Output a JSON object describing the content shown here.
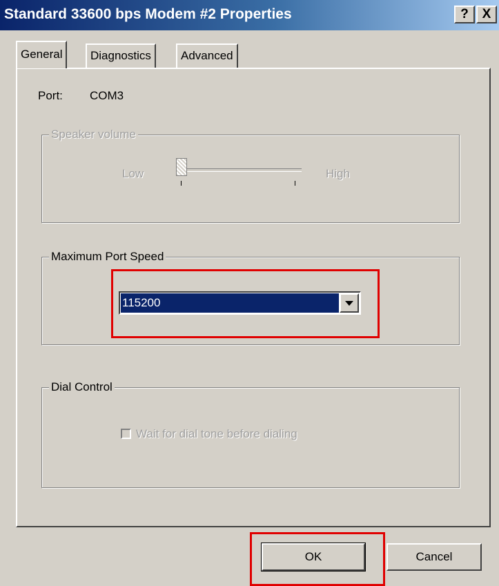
{
  "window": {
    "title": "Standard 33600 bps Modem #2 Properties",
    "help_button": "?",
    "close_button": "X"
  },
  "tabs": [
    {
      "label": "General"
    },
    {
      "label": "Diagnostics"
    },
    {
      "label": "Advanced"
    }
  ],
  "port": {
    "label": "Port:",
    "value": "COM3"
  },
  "speaker_volume": {
    "legend": "Speaker volume",
    "low": "Low",
    "high": "High",
    "level": 0
  },
  "max_port_speed": {
    "legend": "Maximum Port Speed",
    "selected": "115200"
  },
  "dial_control": {
    "legend": "Dial Control",
    "checkbox_label": "Wait for dial tone before dialing",
    "checked": false
  },
  "buttons": {
    "ok": "OK",
    "cancel": "Cancel"
  },
  "colors": {
    "highlight_box": "#e00000",
    "selection": "#0a246a"
  }
}
